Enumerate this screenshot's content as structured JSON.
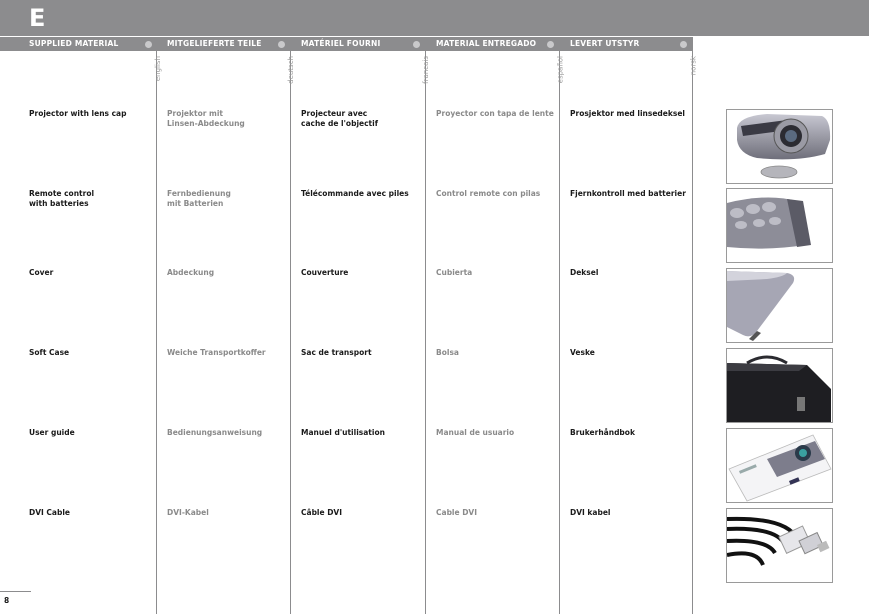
{
  "section_letter": "E",
  "columns": [
    {
      "header": "SUPPLIED MATERIAL",
      "lang": "english"
    },
    {
      "header": "MITGELIEFERTE TEILE",
      "lang": "deutsch"
    },
    {
      "header": "MATÉRIEL FOURNI",
      "lang": "francais"
    },
    {
      "header": "MATERIAL ENTREGADO",
      "lang": "español"
    },
    {
      "header": "LEVERT UTSTYR",
      "lang": "norsk"
    }
  ],
  "rows": [
    {
      "en": "Projector with lens cap",
      "de": "Projektor mit\nLinsen-Abdeckung",
      "fr": "Projecteur avec\ncache de l'objectif",
      "es": "Proyector con tapa de lente",
      "no": "Prosjektor med linsedeksel"
    },
    {
      "en": "Remote control\nwith batteries",
      "de": "Fernbedienung\nmit Batterien",
      "fr": "Télécommande avec piles",
      "es": "Control remote con pilas",
      "no": "Fjernkontroll med batterier"
    },
    {
      "en": "Cover",
      "de": "Abdeckung",
      "fr": "Couverture",
      "es": "Cubierta",
      "no": "Deksel"
    },
    {
      "en": "Soft Case",
      "de": "Weiche Transportkoffer",
      "fr": "Sac de transport",
      "es": "Bolsa",
      "no": "Veske"
    },
    {
      "en": "User guide",
      "de": "Bedienungsanweisung",
      "fr": "Manuel d'utilisation",
      "es": "Manual de usuario",
      "no": "Brukerhåndbok"
    },
    {
      "en": "DVI Cable",
      "de": "DVI-Kabel",
      "fr": "Câble DVI",
      "es": "Cable DVI",
      "no": "DVI kabel"
    }
  ],
  "thumb_icons": [
    "projector-image",
    "remote-control-image",
    "cover-image",
    "soft-case-image",
    "user-guide-image",
    "dvi-cable-image"
  ],
  "page_number": "8",
  "colors": {
    "bar": "#8c8c8e",
    "text_dark": "#1a1a1a",
    "text_grey": "#8a8a8a"
  }
}
